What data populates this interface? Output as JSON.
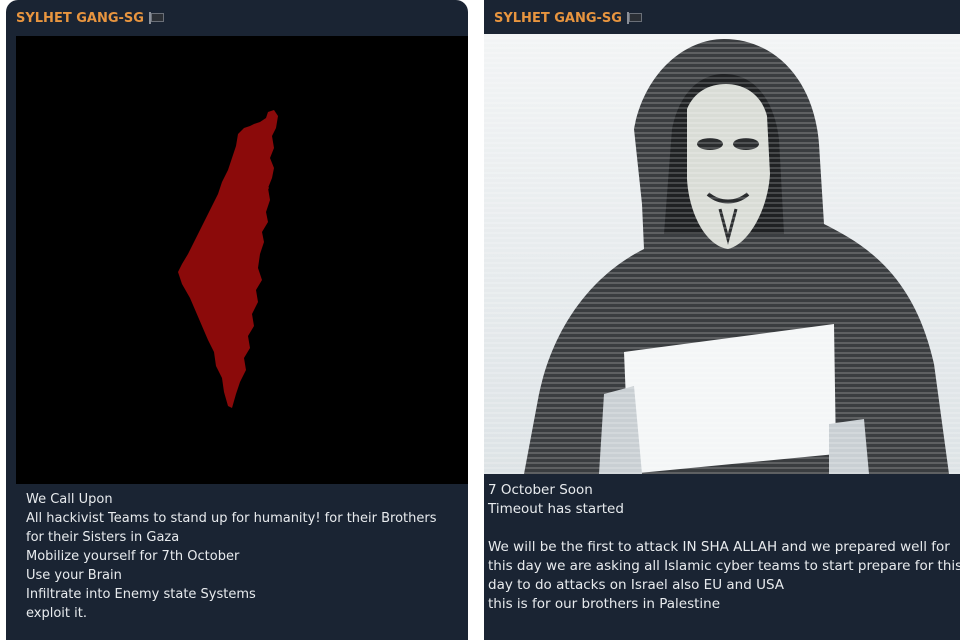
{
  "left_post": {
    "channel_name": "SYLHET GANG-SG",
    "flag_icon": "black-flag-icon",
    "map_color": "#8b0a0a",
    "caption_lines": [
      "We Call Upon",
      "All hackivist Teams to stand up for humanity! for their Brothers",
      "for their Sisters in Gaza",
      "Mobilize yourself for 7th October",
      "Use your Brain",
      "Infiltrate into Enemy state Systems",
      "exploit it."
    ]
  },
  "right_post": {
    "channel_name": "SYLHET GANG-SG",
    "flag_icon": "black-flag-icon",
    "caption_lines": [
      "7 October Soon",
      "Timeout has started",
      "",
      "We will be the first to attack IN SHA ALLAH and we prepared well for",
      "this day we are asking all Islamic cyber teams to start prepare for this",
      "day to do attacks on Israel also EU and USA",
      "this is for our brothers in Palestine"
    ]
  },
  "colors": {
    "bubble_bg": "#1a2433",
    "channel_name": "#e8953f",
    "caption_text": "#e8ebee"
  }
}
